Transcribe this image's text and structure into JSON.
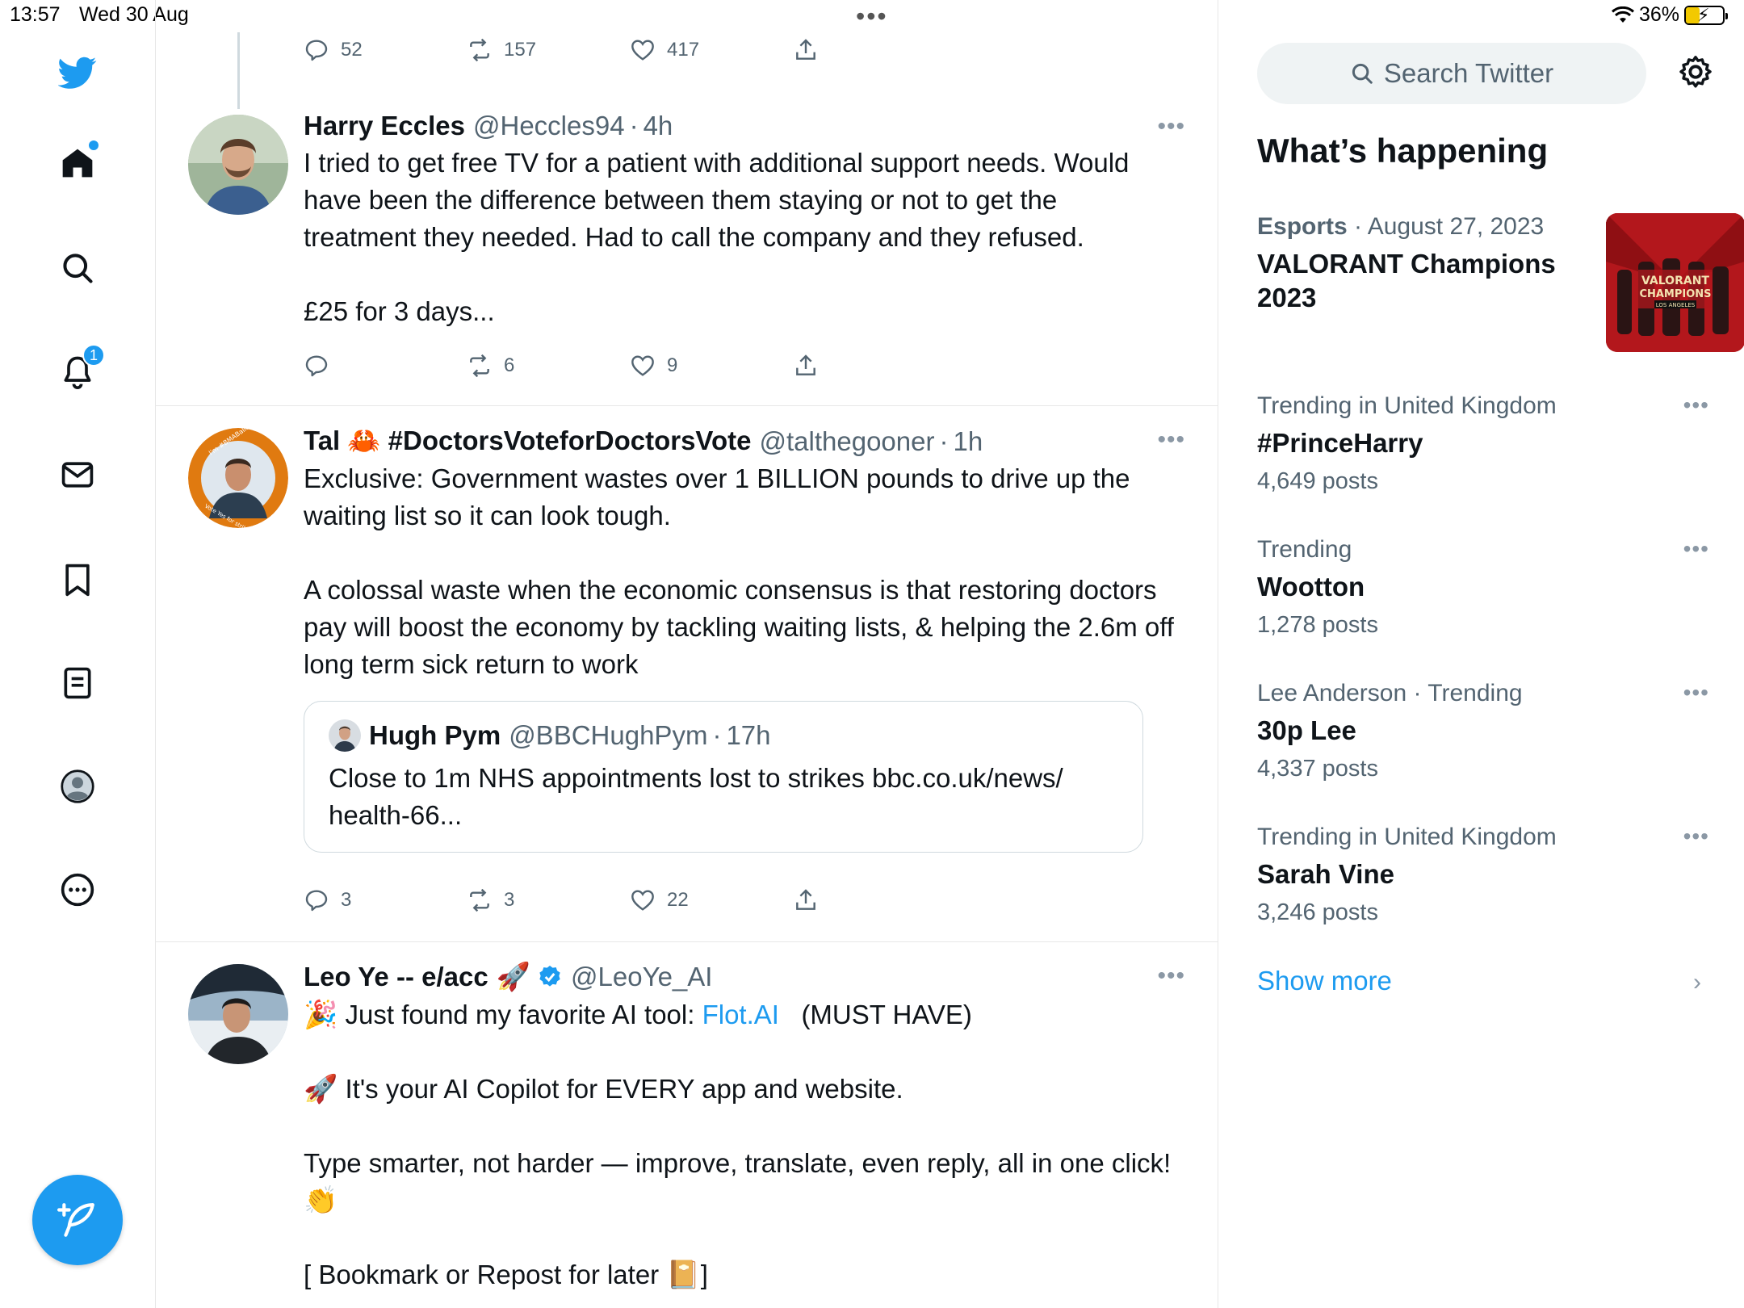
{
  "status_bar": {
    "time": "13:57",
    "date": "Wed 30 Aug",
    "dots": "•••",
    "battery": "36%"
  },
  "nav": {
    "notifications_badge": "1"
  },
  "tweets": [
    {
      "actions": {
        "replies": "52",
        "reposts": "157",
        "likes": "417"
      }
    },
    {
      "name": "Harry Eccles",
      "handle": "@Heccles94",
      "time": "4h",
      "text": "I tried to get free TV for a patient with additional support needs. Would have been the difference between them staying or not to get the treatment they needed. Had to call the company and they refused.\n\n£25 for 3 days...",
      "actions": {
        "replies": "",
        "reposts": "6",
        "likes": "9"
      }
    },
    {
      "name": "Tal 🦀 #DoctorsVoteforDoctorsVote",
      "handle": "@talthegooner",
      "time": "1h",
      "text": "Exclusive: Government wastes over 1 BILLION pounds to drive up the waiting list so it can look tough.\n\nA colossal waste when the economic consensus is that restoring doctors pay will boost the economy by tackling waiting lists, & helping the 2.6m off long term sick return to work",
      "avatar_ring_text_1": "I'm #BMABallotReady",
      "avatar_ring_text_2": "Vote Yes for strike action",
      "quote": {
        "name": "Hugh Pym",
        "handle": "@BBCHughPym",
        "time": "17h",
        "text": "Close to 1m NHS appointments lost to strikes bbc.co.uk/news/\nhealth-66..."
      },
      "actions": {
        "replies": "3",
        "reposts": "3",
        "likes": "22"
      }
    },
    {
      "name": "Leo Ye -- e/acc",
      "handle": "@LeoYe_AI",
      "line1_pre": "Just found my favorite AI tool: ",
      "line1_link": "Flot.AI",
      "line1_post": "   (MUST HAVE)",
      "line2": "It's your AI Copilot for EVERY app and website.",
      "line3": "Type smarter, not harder — improve, translate, even reply, all in one click! ",
      "line4_pre": "[ Bookmark or Repost for later ",
      "line4_post": "]"
    }
  ],
  "sidebar": {
    "search_placeholder": "Search Twitter",
    "section_title": "What’s happening",
    "trends": [
      {
        "category": "Esports",
        "date": "August 27, 2023",
        "title": "VALORANT Champions 2023",
        "image_text_1": "VALORANT",
        "image_text_2": "CHAMPIONS",
        "image_text_3": "LOS ANGELES"
      },
      {
        "meta": "Trending in United Kingdom",
        "title": "#PrinceHarry",
        "count": "4,649 posts"
      },
      {
        "meta": "Trending",
        "title": "Wootton",
        "count": "1,278 posts"
      },
      {
        "meta": "Lee Anderson · Trending",
        "title": "30p Lee",
        "count": "4,337 posts"
      },
      {
        "meta": "Trending in United Kingdom",
        "title": "Sarah Vine",
        "count": "3,246 posts"
      }
    ],
    "show_more": "Show more"
  },
  "colors": {
    "accent": "#1d9bf0",
    "text_primary": "#0f1419",
    "text_secondary": "#536471"
  }
}
